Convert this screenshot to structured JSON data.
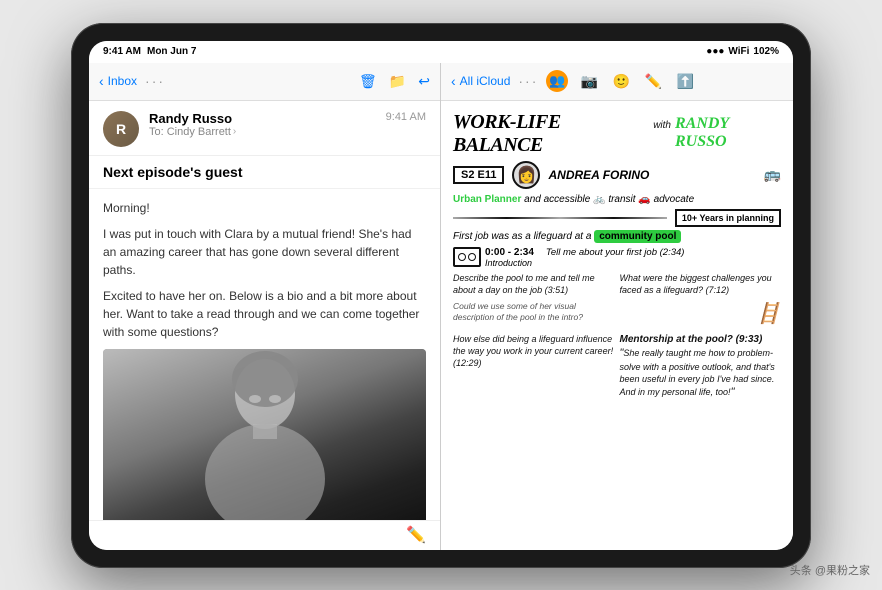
{
  "device": {
    "type": "iPad",
    "status_bar": {
      "time": "9:41 AM",
      "day": "Mon Jun 7",
      "battery": "102%",
      "signal": "●●●"
    }
  },
  "mail_panel": {
    "nav": {
      "back_label": "Inbox",
      "actions": [
        "trash",
        "folder",
        "reply"
      ]
    },
    "email": {
      "sender_name": "Randy Russo",
      "sender_initial": "R",
      "to": "To: Cindy Barrett",
      "time": "9:41 AM",
      "subject": "Next episode's guest",
      "greeting": "Morning!",
      "body_1": "I was put in touch with Clara by a mutual friend! She's had an amazing career that has gone down several different paths.",
      "body_2": "Excited to have her on. Below is a bio and a bit more about her. Want to take a read through and we can come together with some questions?"
    }
  },
  "notes_panel": {
    "nav": {
      "back_label": "All iCloud",
      "icons": [
        "person-group",
        "camera",
        "smiley",
        "pencil",
        "share"
      ]
    },
    "sketch": {
      "main_title": "WORK-LIFE BALANCE",
      "with_text": "with",
      "guest_name": "RANDY RUSSO",
      "episode": "S2 E11",
      "host_name": "ANDREA FORINO",
      "description": "Urban Planner and accessible transit advocate",
      "years": "10+ Years in planning",
      "first_job": "First job was as a lifeguard at a community pool",
      "intro_time": "0:00 - 2:34",
      "intro_label": "Introduction",
      "q1_time": "Tell me about your first job (2:34)",
      "q2": "Describe the pool to me and tell me about a day on the job (3:51)",
      "q3": "What were the biggest challenges you faced as a lifeguard? (7:12)",
      "note1": "Could we use some of her visual description of the pool in the intro?",
      "q4": "How else did being a lifeguard influence the way you work in your current career! (12:29)",
      "q5": "Mentorship at the pool? (9:33)",
      "quote": "She really taught me how to problem-solve with a positive outlook, and that's been useful in every job I've had since. And in my personal life, too!"
    }
  },
  "watermark": {
    "site": "头条 @果粉之家"
  }
}
